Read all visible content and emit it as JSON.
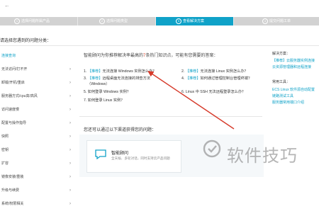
{
  "topbar": {
    "nav_glyph": "←"
  },
  "steps": [
    {
      "num": "1",
      "label": "选择问题所属产品"
    },
    {
      "num": "2",
      "label": "选择问题类型"
    },
    {
      "num": "3",
      "label": "查看解决方案"
    },
    {
      "num": "4",
      "label": "提交问题工单"
    }
  ],
  "header": {
    "prompt": "请选择您遇到的问题分类："
  },
  "sidebar": {
    "items": [
      {
        "label": "连接查询",
        "active": true
      },
      {
        "label": "无法访问/打不开"
      },
      {
        "label": "卸载/开机/重启"
      },
      {
        "label": "服务器方式/cpu高/高风"
      },
      {
        "label": "访问速度慢"
      },
      {
        "label": "配置与操作指导"
      },
      {
        "label": "快照"
      },
      {
        "label": "密钥"
      },
      {
        "label": "扩容"
      },
      {
        "label": "镜像安装/重装"
      },
      {
        "label": "升级与续费"
      },
      {
        "label": "系统/权限相关"
      }
    ]
  },
  "main": {
    "intro_prefix": "智能顾问为你推荐解决率最高的",
    "intro_count": "7",
    "intro_suffix": "条热门知识点，可能有您需要的答案：",
    "items": [
      {
        "num": "1.",
        "tag": "【推荐】",
        "text": "无法连接 Windows 实例怎么办？"
      },
      {
        "num": "2.",
        "tag": "【推荐】",
        "text": "无法连接 Linux 实例怎么办？"
      },
      {
        "num": "3.",
        "tag": "【推荐】",
        "text": "远程桌面无法连接的排查方法"
      },
      {
        "num": "",
        "tag": "",
        "text": "（Windows）"
      },
      {
        "num": "4.",
        "tag": "【推荐】",
        "text": "如何通过管理控制台管理终端？"
      },
      {
        "num": "5.",
        "tag": "",
        "text": "如何登录 Windows 实例？"
      },
      {
        "num": "6.",
        "tag": "",
        "text": "Linux 中 SSH 无法远程登录怎么办？"
      },
      {
        "num": "7.",
        "tag": "",
        "text": "如何登录 Linux 实例？"
      }
    ],
    "consult_prompt": "您还可以通过以下渠道获得您的问题：",
    "card": {
      "title": "智能顾问",
      "desc": "全天候、多轮对话，同时支持云产品问题"
    }
  },
  "right_panel": {
    "solutions_title": "解决方案：",
    "solutions": [
      "【推荐】云服务器实例连接",
      "云资源管理器和远程连接"
    ],
    "tools_title": "常用工具：",
    "tools": [
      "ECS Linux 软件源自动配置",
      "链路测试工具",
      "服务器常用端口介绍"
    ]
  },
  "watermark": {
    "text": "软件技巧"
  },
  "colors": {
    "accent": "#10a2c8",
    "highlight": "#e04a2f",
    "arrow": "#d63a2a"
  }
}
